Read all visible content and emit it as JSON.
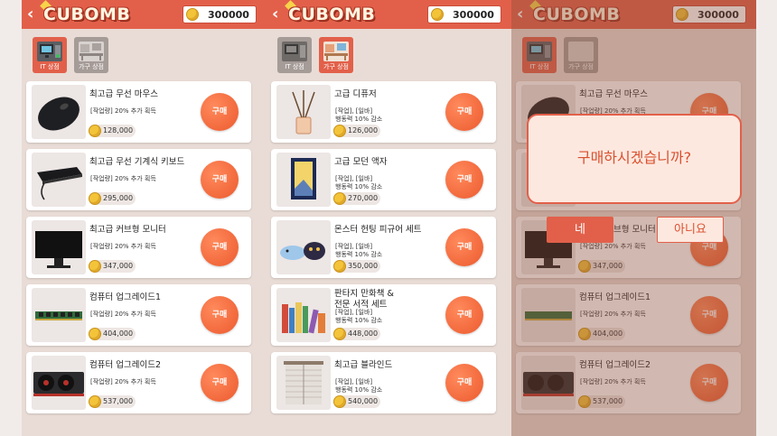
{
  "header": {
    "logo": "CUBOMB",
    "coins": "300000"
  },
  "tabs": {
    "it": "IT 상점",
    "furniture": "가구 상점"
  },
  "buy_label": "구매",
  "it_items": [
    {
      "name": "최고급 무선 마우스",
      "desc": "[작업량] 20% 추가 획득",
      "price": "128,000"
    },
    {
      "name": "최고급 무선 기계식 키보드",
      "desc": "[작업량] 20% 추가 획득",
      "price": "295,000"
    },
    {
      "name": "최고급 커브형 모니터",
      "desc": "[작업량] 20% 추가 획득",
      "price": "347,000"
    },
    {
      "name": "컴퓨터 업그레이드1",
      "desc": "[작업량] 20% 추가 획득",
      "price": "404,000"
    },
    {
      "name": "컴퓨터 업그레이드2",
      "desc": "[작업량] 20% 추가 획득",
      "price": "537,000"
    }
  ],
  "furniture_items": [
    {
      "name": "고급 디퓨저",
      "desc": "[작업], [일바]\n행동력 10% 감소",
      "price": "126,000"
    },
    {
      "name": "고급 모던 액자",
      "desc": "[작업], [일바]\n행동력 10% 감소",
      "price": "270,000"
    },
    {
      "name": "몬스터 헌팅 피규어 세트",
      "desc": "[작업], [일바]\n행동력 10% 감소",
      "price": "350,000"
    },
    {
      "name": "판타지 만화책 &\n전문 서적 세트",
      "desc": "[작업], [일바]\n행동력 10% 감소",
      "price": "448,000"
    },
    {
      "name": "최고급 블라인드",
      "desc": "[작업], [일바]\n행동력 10% 감소",
      "price": "540,000"
    }
  ],
  "dialog": {
    "question": "구매하시겠습니까?",
    "yes": "네",
    "no": "아니요"
  },
  "colors": {
    "accent": "#e2604a",
    "buy": "#ec5a2e",
    "coin": "#f3c43a",
    "panel": "#e9dcd6"
  }
}
